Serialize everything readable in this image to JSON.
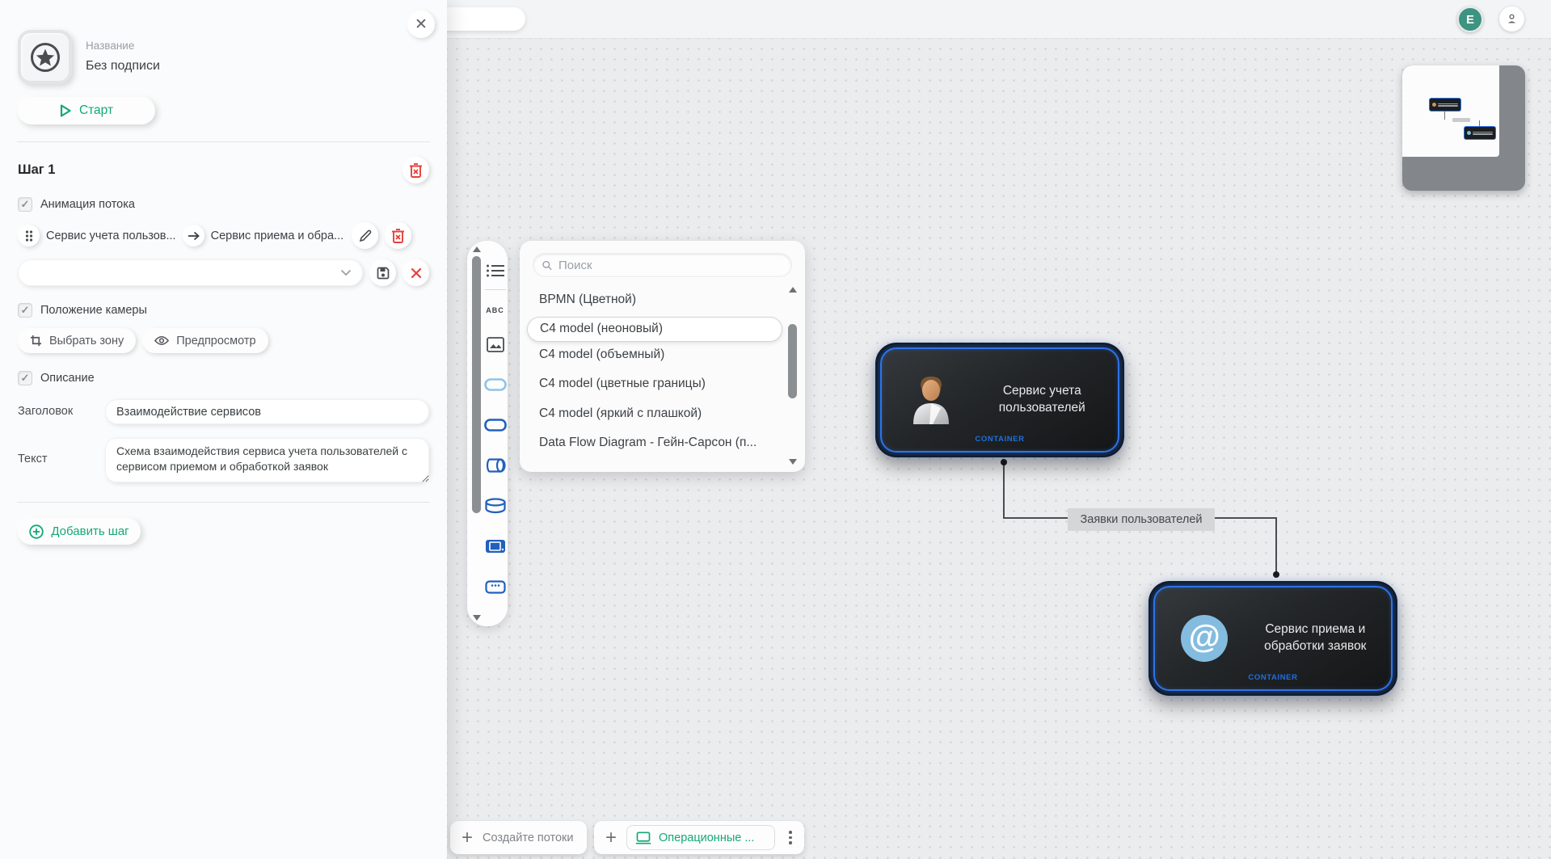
{
  "colors": {
    "accent_green": "#13a876",
    "danger_red": "#e5413e",
    "node_border_blue": "#2e74e8",
    "container_badge_blue": "#1f6fe0"
  },
  "topbar": {
    "avatar_initial": "E"
  },
  "sidebar": {
    "name_label": "Название",
    "name_value": "Без подписи",
    "start_button": "Старт",
    "step": {
      "title": "Шаг 1",
      "flow_animation_label": "Анимация потока",
      "flow_source": "Сервис учета пользов...",
      "flow_target": "Сервис приема и обра...",
      "camera_label": "Положение камеры",
      "select_zone_button": "Выбрать зону",
      "preview_button": "Предпросмотр",
      "description_label": "Описание",
      "heading_label": "Заголовок",
      "heading_value": "Взаимодействие сервисов",
      "text_label": "Текст",
      "text_value": "Схема взаимодействия сервиса учета пользователей с сервисом приемом и обработкой заявок",
      "checkbox_glyph": "✓"
    },
    "add_step_button": "Добавить шаг"
  },
  "palette": {
    "text_tool": "ABC"
  },
  "styles_panel": {
    "search_placeholder": "Поиск",
    "items": [
      "BPMN (Цветной)",
      "C4 model (неоновый)",
      "C4 model (объемный)",
      "C4 model (цветные границы)",
      "C4 model (яркий с плашкой)",
      "Data Flow Diagram - Гейн-Сарсон (п..."
    ],
    "selected_item": "C4 model (неоновый)"
  },
  "diagram": {
    "nodes": [
      {
        "title": "Сервис учета пользователей",
        "badge": "CONTAINER",
        "icon": "person"
      },
      {
        "title": "Сервис приема и обработки заявок",
        "badge": "CONTAINER",
        "icon": "at-sign",
        "icon_glyph": "@"
      }
    ],
    "edge_label": "Заявки пользователей"
  },
  "footer": {
    "create_flows_button": "Создайте потоки",
    "active_tab": "Операционные ..."
  }
}
